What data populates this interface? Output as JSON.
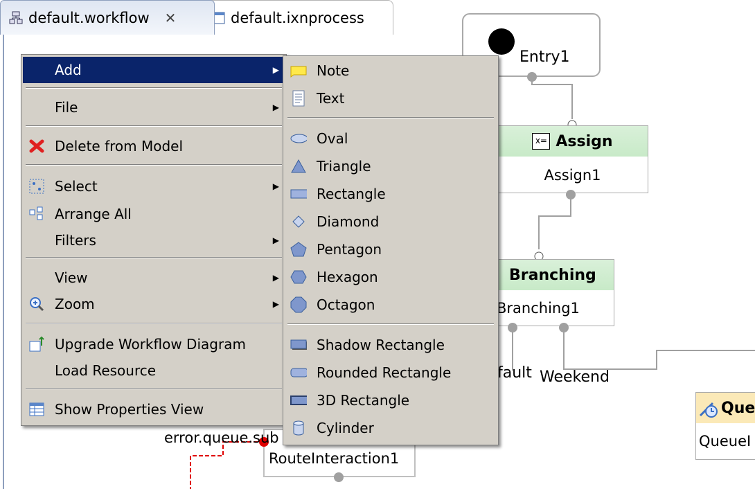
{
  "tabs": [
    {
      "label": "default.workflow",
      "close": "✕"
    },
    {
      "label": "default.ixnprocess"
    }
  ],
  "diagram": {
    "entry_label": "Entry1",
    "assign_header": "Assign",
    "assign_label": "Assign1",
    "branching_header": "Branching",
    "branching_label": "Branching1",
    "default_edge": "fault",
    "weekend_edge": "Weekend",
    "queue_header": "Que",
    "queue_label": "QueueI",
    "error_edge": "error.queue.sub",
    "route_label": "RouteInteraction1"
  },
  "context_menu": {
    "add": "Add",
    "file": "File",
    "delete": "Delete from Model",
    "select": "Select",
    "arrange_all": "Arrange All",
    "filters": "Filters",
    "view": "View",
    "zoom": "Zoom",
    "upgrade": "Upgrade Workflow Diagram",
    "load_resource": "Load Resource",
    "show_properties": "Show Properties View"
  },
  "add_submenu": {
    "note": "Note",
    "text": "Text",
    "oval": "Oval",
    "triangle": "Triangle",
    "rectangle": "Rectangle",
    "diamond": "Diamond",
    "pentagon": "Pentagon",
    "hexagon": "Hexagon",
    "octagon": "Octagon",
    "shadow_rectangle": "Shadow Rectangle",
    "rounded_rectangle": "Rounded Rectangle",
    "rectangle_3d": "3D Rectangle",
    "cylinder": "Cylinder"
  },
  "colors": {
    "menu_bg": "#d4d0c8",
    "highlight": "#0a246a",
    "node_header": "#c8eac8",
    "queue_header": "#fbe9b7",
    "error_red": "#e00000"
  }
}
